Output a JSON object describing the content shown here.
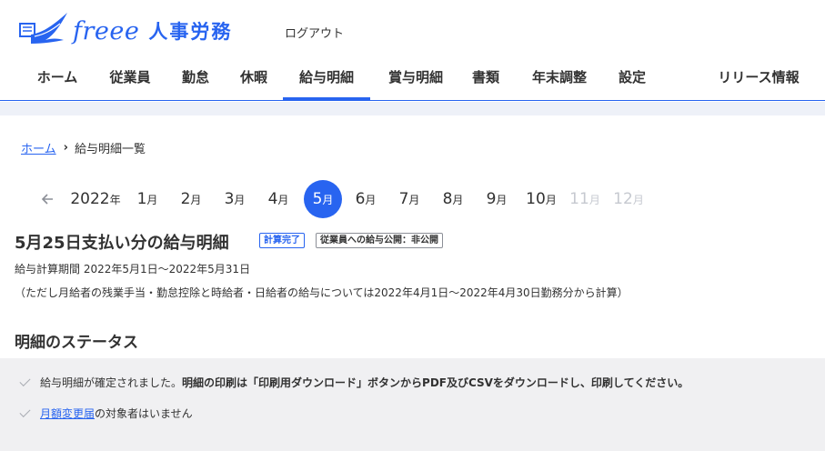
{
  "header": {
    "logo_brand": "freee",
    "logo_product": "人事労務",
    "logout_label": "ログアウト",
    "nav": [
      {
        "label": "ホーム"
      },
      {
        "label": "従業員"
      },
      {
        "label": "勤怠"
      },
      {
        "label": "休暇"
      },
      {
        "label": "給与明細",
        "active": true
      },
      {
        "label": "賞与明細"
      },
      {
        "label": "書類"
      },
      {
        "label": "年末調整"
      },
      {
        "label": "設定"
      },
      {
        "label": "リリース情報"
      }
    ]
  },
  "breadcrumb": {
    "home": "ホーム",
    "separator": "›",
    "current": "給与明細一覧"
  },
  "month_nav": {
    "prev_icon": "arrow-left-icon",
    "year": "2022",
    "year_suffix": "年",
    "month_suffix": "月",
    "months": [
      {
        "num": "1",
        "state": "enabled"
      },
      {
        "num": "2",
        "state": "enabled"
      },
      {
        "num": "3",
        "state": "enabled"
      },
      {
        "num": "4",
        "state": "enabled"
      },
      {
        "num": "5",
        "state": "current"
      },
      {
        "num": "6",
        "state": "enabled"
      },
      {
        "num": "7",
        "state": "enabled"
      },
      {
        "num": "8",
        "state": "enabled"
      },
      {
        "num": "9",
        "state": "enabled"
      },
      {
        "num": "10",
        "state": "enabled"
      },
      {
        "num": "11",
        "state": "disabled"
      },
      {
        "num": "12",
        "state": "disabled"
      }
    ]
  },
  "payslip": {
    "title": "5月25日支払い分の給与明細",
    "badge_status": "計算完了",
    "badge_publish": "従業員への給与公開：非公開",
    "period": "給与計算期間 2022年5月1日〜2022年5月31日",
    "note": "（ただし月給者の残業手当・勤怠控除と時給者・日給者の給与については2022年4月1日〜2022年4月30日勤務分から計算）"
  },
  "status": {
    "title": "明細のステータス",
    "row1_text": "給与明細が確定されました。",
    "row1_bold": "明細の印刷は「印刷用ダウンロード」ボタンからPDF及びCSVをダウンロードし、印刷してください。",
    "row2_link": "月額変更届",
    "row2_text": "の対象者はいません"
  },
  "colors": {
    "accent": "#2864f0",
    "text": "#323232",
    "disabled": "#c6c9d0",
    "status_bg": "#f0f0f2"
  }
}
